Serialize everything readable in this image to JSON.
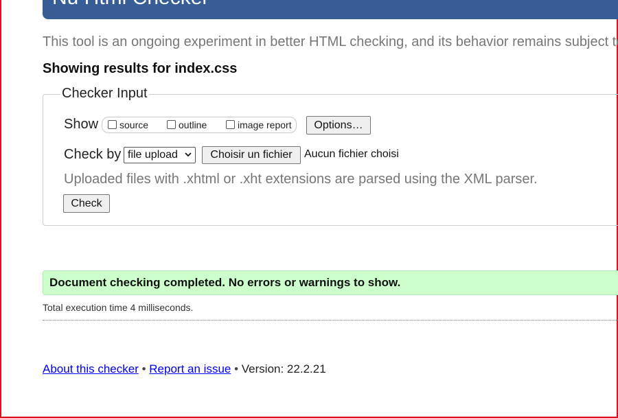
{
  "header": {
    "title": "Nu Html Checker"
  },
  "intro_text": "This tool is an ongoing experiment in better HTML checking, and its behavior remains subject to",
  "results_heading": "Showing results for index.css",
  "checker_input": {
    "legend": "Checker Input",
    "show_label": "Show",
    "checkboxes": [
      {
        "label": "source",
        "checked": false
      },
      {
        "label": "outline",
        "checked": false
      },
      {
        "label": "image report",
        "checked": false
      }
    ],
    "options_button": "Options…",
    "check_by_label": "Check by",
    "check_by_selected": "file upload",
    "choose_file_button": "Choisir un fichier",
    "no_file_text": "Aucun fichier choisi",
    "hint": "Uploaded files with .xhtml or .xht extensions are parsed using the XML parser.",
    "check_button": "Check"
  },
  "result": {
    "message": "Document checking completed. No errors or warnings to show.",
    "exec_time": "Total execution time 4 milliseconds."
  },
  "footer": {
    "about_link": "About this checker",
    "separator": "•",
    "report_link": "Report an issue",
    "version": "Version: 22.2.21"
  },
  "colors": {
    "header_bg": "#365d95",
    "success_bg": "#ccffcc",
    "link": "#0000ee",
    "frame_border": "#e0101a"
  }
}
